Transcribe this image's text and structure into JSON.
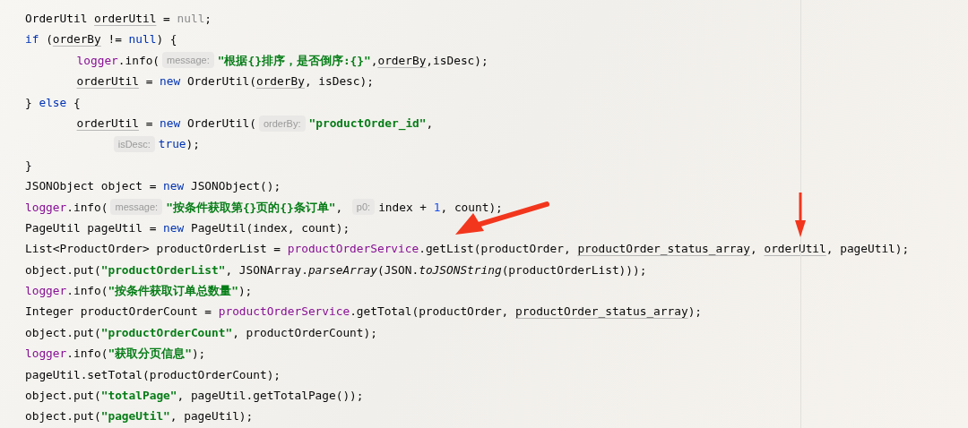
{
  "code_lines": [
    {
      "tokens": [
        {
          "text": "OrderUtil ",
          "kind": "plain"
        },
        {
          "text": "orderUtil",
          "kind": "ref"
        },
        {
          "text": " = ",
          "kind": "plain"
        },
        {
          "text": "null",
          "kind": "muted"
        },
        {
          "text": ";",
          "kind": "plain"
        }
      ]
    },
    {
      "tokens": [
        {
          "text": "if",
          "kind": "kw"
        },
        {
          "text": " (",
          "kind": "plain"
        },
        {
          "text": "orderBy",
          "kind": "ref"
        },
        {
          "text": " != ",
          "kind": "plain"
        },
        {
          "text": "null",
          "kind": "kw"
        },
        {
          "text": ") {",
          "kind": "plain"
        }
      ],
      "children": [
        {
          "tokens": [
            {
              "text": "logger",
              "kind": "field"
            },
            {
              "text": ".info(",
              "kind": "plain"
            },
            {
              "text": "message:",
              "kind": "hint"
            },
            {
              "text": "\"根据{}排序，是否倒序:{}\"",
              "kind": "str"
            },
            {
              "text": ",",
              "kind": "plain"
            },
            {
              "text": "orderBy",
              "kind": "ref"
            },
            {
              "text": ",isDesc);",
              "kind": "plain"
            }
          ]
        },
        {
          "tokens": [
            {
              "text": "orderUtil",
              "kind": "ref"
            },
            {
              "text": " = ",
              "kind": "plain"
            },
            {
              "text": "new",
              "kind": "kw"
            },
            {
              "text": " OrderUtil(",
              "kind": "plain"
            },
            {
              "text": "orderBy",
              "kind": "ref"
            },
            {
              "text": ", isDesc);",
              "kind": "plain"
            }
          ]
        }
      ]
    },
    {
      "tokens": [
        {
          "text": "} ",
          "kind": "plain"
        },
        {
          "text": "else",
          "kind": "kw"
        },
        {
          "text": " {",
          "kind": "plain"
        }
      ],
      "children": [
        {
          "tokens": [
            {
              "text": "orderUtil",
              "kind": "ref"
            },
            {
              "text": " = ",
              "kind": "plain"
            },
            {
              "text": "new",
              "kind": "kw"
            },
            {
              "text": " OrderUtil(",
              "kind": "plain"
            },
            {
              "text": "orderBy:",
              "kind": "hint"
            },
            {
              "text": "\"productOrder_id\"",
              "kind": "str"
            },
            {
              "text": ",",
              "kind": "plain"
            }
          ],
          "children": [
            {
              "tokens": [
                {
                  "text": "isDesc:",
                  "kind": "hint"
                },
                {
                  "text": "true",
                  "kind": "kw"
                },
                {
                  "text": ");",
                  "kind": "plain"
                }
              ]
            }
          ]
        }
      ]
    },
    {
      "tokens": [
        {
          "text": "}",
          "kind": "plain"
        }
      ]
    },
    {
      "tokens": [
        {
          "text": "JSONObject object = ",
          "kind": "plain"
        },
        {
          "text": "new",
          "kind": "kw"
        },
        {
          "text": " JSONObject();",
          "kind": "plain"
        }
      ]
    },
    {
      "tokens": [
        {
          "text": "logger",
          "kind": "field"
        },
        {
          "text": ".info(",
          "kind": "plain"
        },
        {
          "text": "message:",
          "kind": "hint"
        },
        {
          "text": "\"按条件获取第{}页的{}条订单\"",
          "kind": "str"
        },
        {
          "text": ", ",
          "kind": "plain"
        },
        {
          "text": "p0:",
          "kind": "hint"
        },
        {
          "text": "index + ",
          "kind": "plain"
        },
        {
          "text": "1",
          "kind": "num"
        },
        {
          "text": ", count);",
          "kind": "plain"
        }
      ]
    },
    {
      "tokens": [
        {
          "text": "PageUtil pageUtil = ",
          "kind": "plain"
        },
        {
          "text": "new",
          "kind": "kw"
        },
        {
          "text": " PageUtil(index, count);",
          "kind": "plain"
        }
      ]
    },
    {
      "tokens": [
        {
          "text": "List<ProductOrder> productOrderList = ",
          "kind": "plain"
        },
        {
          "text": "productOrderService",
          "kind": "field"
        },
        {
          "text": ".getList(productOrder, ",
          "kind": "plain"
        },
        {
          "text": "productOrder_status_array",
          "kind": "ref"
        },
        {
          "text": ", ",
          "kind": "plain"
        },
        {
          "text": "orderUtil",
          "kind": "ref"
        },
        {
          "text": ", pageUtil);",
          "kind": "plain"
        }
      ]
    },
    {
      "tokens": [
        {
          "text": "object.put(",
          "kind": "plain"
        },
        {
          "text": "\"productOrderList\"",
          "kind": "str"
        },
        {
          "text": ", JSONArray.",
          "kind": "plain"
        },
        {
          "text": "parseArray",
          "kind": "italic"
        },
        {
          "text": "(JSON.",
          "kind": "plain"
        },
        {
          "text": "toJSONString",
          "kind": "italic"
        },
        {
          "text": "(productOrderList)));",
          "kind": "plain"
        }
      ]
    },
    {
      "tokens": [
        {
          "text": "logger",
          "kind": "field"
        },
        {
          "text": ".info(",
          "kind": "plain"
        },
        {
          "text": "\"按条件获取订单总数量\"",
          "kind": "str"
        },
        {
          "text": ");",
          "kind": "plain"
        }
      ]
    },
    {
      "tokens": [
        {
          "text": "Integer productOrderCount = ",
          "kind": "plain"
        },
        {
          "text": "productOrderService",
          "kind": "field"
        },
        {
          "text": ".getTotal(productOrder, ",
          "kind": "plain"
        },
        {
          "text": "productOrder_status_array",
          "kind": "ref"
        },
        {
          "text": ");",
          "kind": "plain"
        }
      ]
    },
    {
      "tokens": [
        {
          "text": "object.put(",
          "kind": "plain"
        },
        {
          "text": "\"productOrderCount\"",
          "kind": "str"
        },
        {
          "text": ", productOrderCount);",
          "kind": "plain"
        }
      ]
    },
    {
      "tokens": [
        {
          "text": "logger",
          "kind": "field"
        },
        {
          "text": ".info(",
          "kind": "plain"
        },
        {
          "text": "\"获取分页信息\"",
          "kind": "str"
        },
        {
          "text": ");",
          "kind": "plain"
        }
      ]
    },
    {
      "tokens": [
        {
          "text": "pageUtil.setTotal(productOrderCount);",
          "kind": "plain"
        }
      ]
    },
    {
      "tokens": [
        {
          "text": "object.put(",
          "kind": "plain"
        },
        {
          "text": "\"totalPage\"",
          "kind": "str"
        },
        {
          "text": ", pageUtil.getTotalPage());",
          "kind": "plain"
        }
      ]
    },
    {
      "tokens": [
        {
          "text": "object.put(",
          "kind": "plain"
        },
        {
          "text": "\"pageUtil\"",
          "kind": "str"
        },
        {
          "text": ", pageUtil);",
          "kind": "plain"
        }
      ]
    }
  ]
}
